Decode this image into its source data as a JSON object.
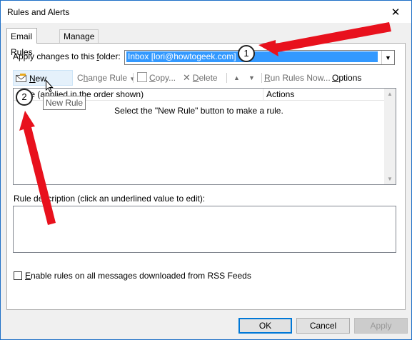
{
  "window": {
    "title": "Rules and Alerts"
  },
  "tabs": [
    {
      "label": "Email Rules"
    },
    {
      "label": "Manage Alerts"
    }
  ],
  "folder": {
    "label_pre": "Apply changes to this ",
    "label_u": "f",
    "label_post": "older:",
    "value": "Inbox [lori@howtogeek.com]"
  },
  "toolbar": {
    "new_rule": {
      "u": "N",
      "rest": "ew Rule..."
    },
    "change_rule": {
      "pre": "C",
      "u": "h",
      "rest": "ange Rule"
    },
    "copy": {
      "u": "C",
      "rest": "opy..."
    },
    "delete": {
      "u": "D",
      "rest": "elete"
    },
    "run_rules": {
      "u": "R",
      "rest": "un Rules Now..."
    },
    "options": {
      "u": "O",
      "rest": "ptions"
    }
  },
  "list": {
    "col_rule": "Rule (applied in the order shown)",
    "col_rule_visible": "ule (applied in the order shown)",
    "col_actions": "Actions",
    "empty": "Select the \"New Rule\" button to make a rule."
  },
  "tooltip": "New Rule",
  "description": {
    "label": "Rule description (click an underlined value to edit):"
  },
  "rss": {
    "u": "E",
    "rest": "nable rules on all messages downloaded from RSS Feeds"
  },
  "buttons": {
    "ok": "OK",
    "cancel": "Cancel",
    "apply": "Apply"
  },
  "callouts": [
    {
      "number": "1"
    },
    {
      "number": "2"
    }
  ],
  "colors": {
    "arrow": "#e8111d",
    "selection": "#3399ff",
    "title_border": "#1e6fc7"
  }
}
